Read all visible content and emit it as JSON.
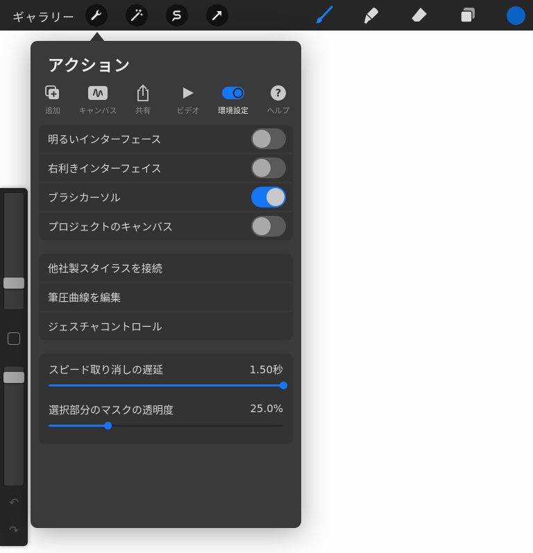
{
  "toolbar": {
    "gallery_label": "ギャラリー",
    "left_tools": [
      "wrench-icon",
      "magic-wand-icon",
      "selection-icon",
      "transform-arrow-icon"
    ],
    "right_tools": [
      "brush-icon",
      "smudge-icon",
      "eraser-icon",
      "layers-icon"
    ],
    "active_color": "#0a62c4",
    "accent_color": "#1577f5"
  },
  "panel": {
    "title": "アクション",
    "tabs": [
      {
        "label": "追加",
        "icon": "add-icon"
      },
      {
        "label": "キャンバス",
        "icon": "canvas-icon"
      },
      {
        "label": "共有",
        "icon": "share-icon"
      },
      {
        "label": "ビデオ",
        "icon": "play-icon"
      },
      {
        "label": "環境設定",
        "icon": "toggle-icon",
        "active": true
      },
      {
        "label": "ヘルプ",
        "icon": "help-icon"
      }
    ],
    "toggles": [
      {
        "label": "明るいインターフェース",
        "on": false
      },
      {
        "label": "右利きインターフェイス",
        "on": false
      },
      {
        "label": "ブラシカーソル",
        "on": true
      },
      {
        "label": "プロジェクトのキャンバス",
        "on": false
      }
    ],
    "links": [
      {
        "label": "他社製スタイラスを接続"
      },
      {
        "label": "筆圧曲線を編集"
      },
      {
        "label": "ジェスチャコントロール"
      }
    ],
    "sliders": [
      {
        "label": "スピード取り消しの遅延",
        "value_text": "1.50秒",
        "fraction": 1.0
      },
      {
        "label": "選択部分のマスクの透明度",
        "value_text": "25.0%",
        "fraction": 0.25
      }
    ]
  },
  "sidebar": {
    "brush_size_fraction": 0.2,
    "opacity_fraction": 0.94
  }
}
